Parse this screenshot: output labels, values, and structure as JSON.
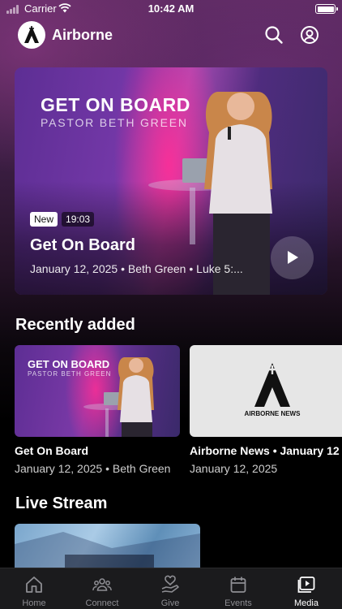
{
  "status_bar": {
    "carrier": "Carrier",
    "time": "10:42 AM"
  },
  "header": {
    "app_name": "Airborne",
    "logo_icon": "airborne-logo-icon",
    "search_icon": "search-icon",
    "profile_icon": "profile-icon"
  },
  "hero": {
    "poster_title": "GET ON BOARD",
    "poster_subtitle": "PASTOR BETH GREEN",
    "badge": "New",
    "duration": "19:03",
    "title": "Get On Board",
    "meta": "January 12, 2025 • Beth Green • Luke 5:...",
    "play_icon": "play-icon"
  },
  "recently_added": {
    "title": "Recently added",
    "items": [
      {
        "thumb_title": "GET ON BOARD",
        "thumb_subtitle": "PASTOR BETH GREEN",
        "title": "Get On Board",
        "meta": "January 12, 2025 • Beth Green"
      },
      {
        "thumb_label": "AIRBORNE NEWS",
        "title": "Airborne News • January 12",
        "meta": "January 12, 2025"
      }
    ]
  },
  "live_stream": {
    "title": "Live Stream"
  },
  "tabs": [
    {
      "label": "Home",
      "icon": "home-icon"
    },
    {
      "label": "Connect",
      "icon": "people-icon"
    },
    {
      "label": "Give",
      "icon": "give-heart-icon"
    },
    {
      "label": "Events",
      "icon": "calendar-icon"
    },
    {
      "label": "Media",
      "icon": "media-play-icon",
      "active": true
    }
  ]
}
